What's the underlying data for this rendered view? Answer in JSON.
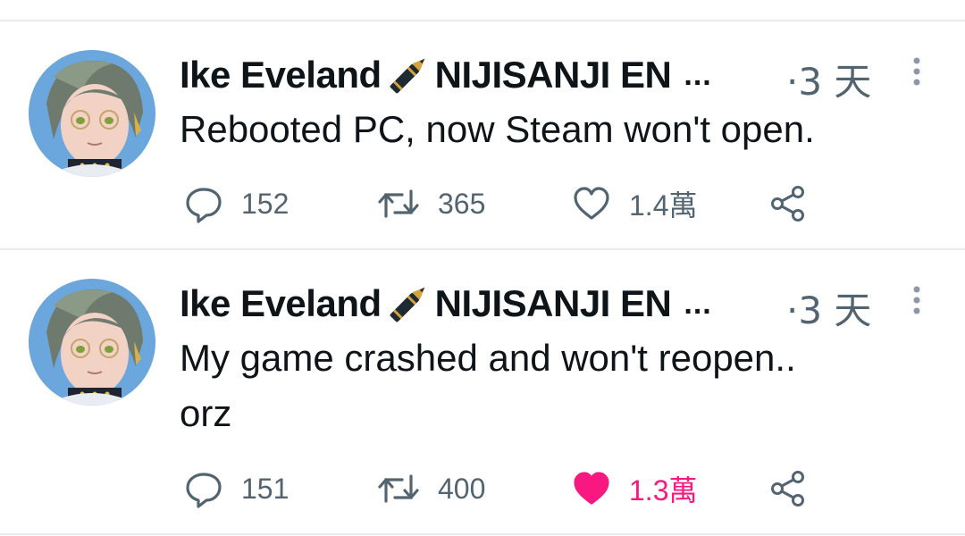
{
  "colors": {
    "secondary_text": "#536471",
    "primary_text": "#0f1419",
    "like_active": "#f91880",
    "divider": "#e6ecf0"
  },
  "tweets": [
    {
      "author": {
        "name_part1": "Ike Eveland",
        "emoji": "pen-icon",
        "name_part2": "NIJISANJI EN",
        "truncation": "..."
      },
      "time": "·3 天",
      "text": "Rebooted PC, now Steam won't open.",
      "stats": {
        "replies": "152",
        "retweets": "365",
        "likes": "1.4萬",
        "liked": false
      }
    },
    {
      "author": {
        "name_part1": "Ike Eveland",
        "emoji": "pen-icon",
        "name_part2": "NIJISANJI EN",
        "truncation": "..."
      },
      "time": "·3 天",
      "text": "My game crashed and won't reopen..\norz",
      "stats": {
        "replies": "151",
        "retweets": "400",
        "likes": "1.3萬",
        "liked": true
      }
    }
  ]
}
